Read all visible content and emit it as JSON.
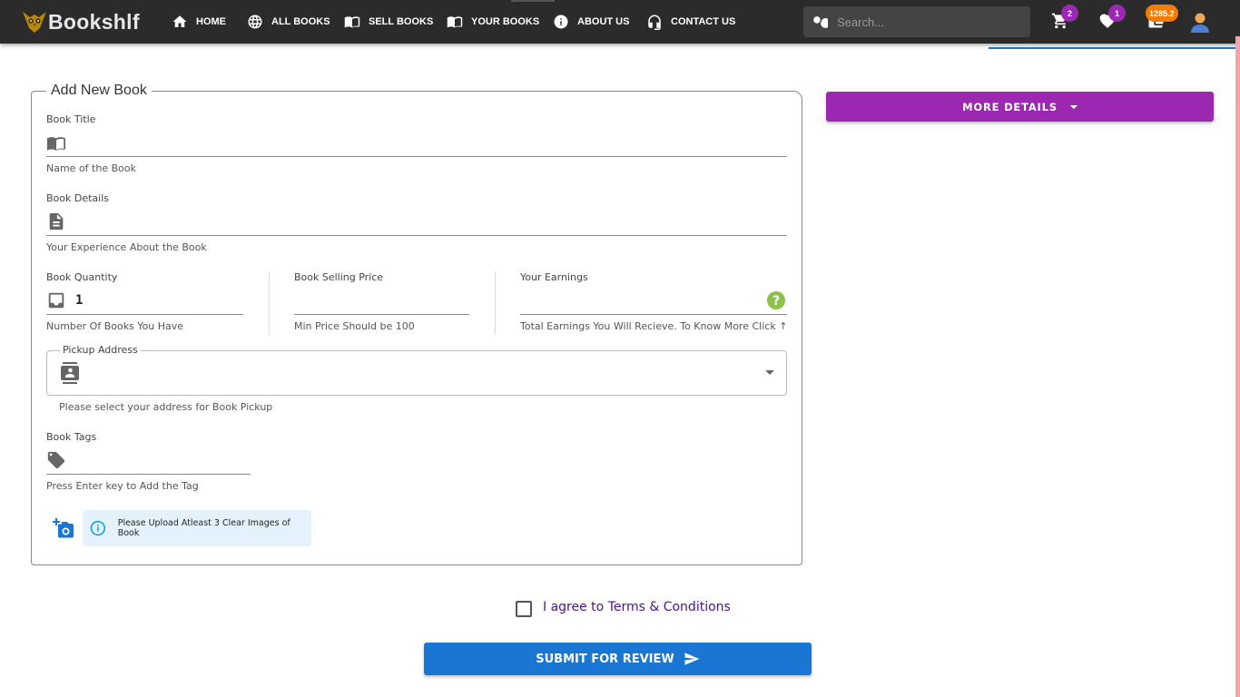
{
  "brand": {
    "name": "Bookshlf",
    "logo_icon": "owl-icon"
  },
  "nav": {
    "items": [
      {
        "label": "HOME",
        "icon": "home-icon"
      },
      {
        "label": "ALL BOOKS",
        "icon": "globe-icon"
      },
      {
        "label": "SELL BOOKS",
        "icon": "book-open-icon"
      },
      {
        "label": "YOUR BOOKS",
        "icon": "book-open-icon"
      },
      {
        "label": "ABOUT US",
        "icon": "info-icon"
      },
      {
        "label": "CONTACT US",
        "icon": "headset-icon"
      }
    ],
    "search_placeholder": "Search...",
    "cart_count": "2",
    "wishlist_count": "1",
    "wallet_balance": "1285.2"
  },
  "form": {
    "legend": "Add New Book",
    "title": {
      "label": "Book Title",
      "hint": "Name of the Book",
      "value": ""
    },
    "details": {
      "label": "Book Details",
      "hint": "Your Experience About the Book",
      "value": ""
    },
    "quantity": {
      "label": "Book Quantity",
      "hint": "Number Of Books You Have",
      "value": "1"
    },
    "price": {
      "label": "Book Selling Price",
      "hint": "Min Price Should be 100",
      "value": ""
    },
    "earnings": {
      "label": "Your Earnings",
      "hint": "Total Earnings You Will Recieve. To Know More Click ↑",
      "value": ""
    },
    "address": {
      "label": "Pickup Address",
      "hint": "Please select your address for Book Pickup",
      "value": ""
    },
    "tags": {
      "label": "Book Tags",
      "hint": "Press Enter key to Add the Tag",
      "value": ""
    },
    "upload_info": "Please Upload Atleast 3 Clear Images of Book"
  },
  "more_details_label": "MORE DETAILS",
  "terms_label": "I agree to Terms & Conditions",
  "submit_label": "SUBMIT FOR REVIEW",
  "colors": {
    "navbar": "#2b2b2b",
    "primary": "#1976d2",
    "accent": "#9c27b0",
    "badge_orange": "#f57c00",
    "terms": "#4a148c",
    "help": "#8bc34a"
  }
}
